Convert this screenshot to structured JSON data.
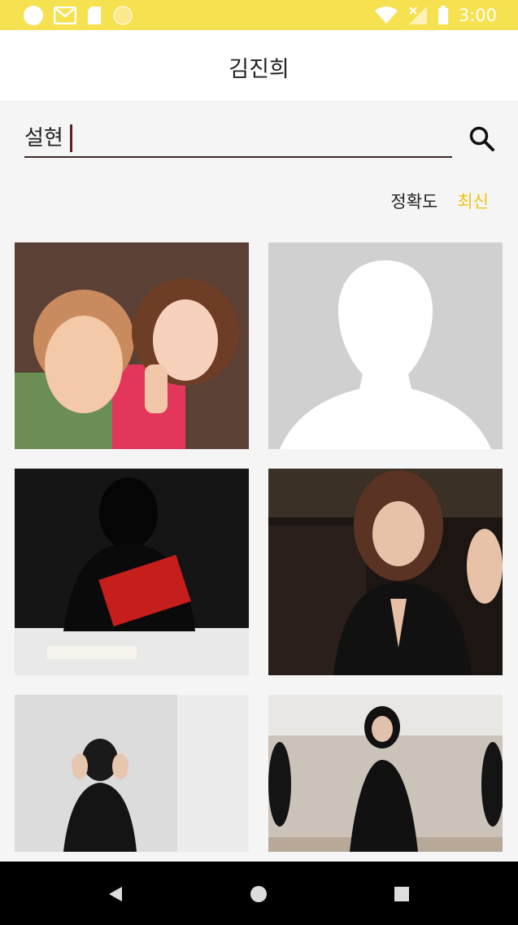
{
  "status_bar": {
    "time": "3:00",
    "left_icons": [
      "circle-icon",
      "gmail-icon",
      "sd-card-icon",
      "face-icon"
    ],
    "right_icons": [
      "wifi-icon",
      "signal-icon",
      "battery-icon"
    ]
  },
  "app_bar": {
    "title": "김진희"
  },
  "search": {
    "value": "설현"
  },
  "sort": {
    "accuracy_label": "정확도",
    "latest_label": "최신"
  },
  "results": [
    {
      "icon": "selfie-photo-image"
    },
    {
      "icon": "placeholder-silhouette-image"
    },
    {
      "icon": "darth-vader-reading-image"
    },
    {
      "icon": "woman-at-night-image"
    },
    {
      "icon": "dance-practice-image-1"
    },
    {
      "icon": "dance-practice-image-2"
    }
  ],
  "nav": {
    "back_icon": "back-triangle-icon",
    "home_icon": "home-circle-icon",
    "recents_icon": "recents-square-icon"
  },
  "colors": {
    "status_bar": "#f6e151",
    "accent": "#f1c40f",
    "underline": "#3f2b2b"
  }
}
